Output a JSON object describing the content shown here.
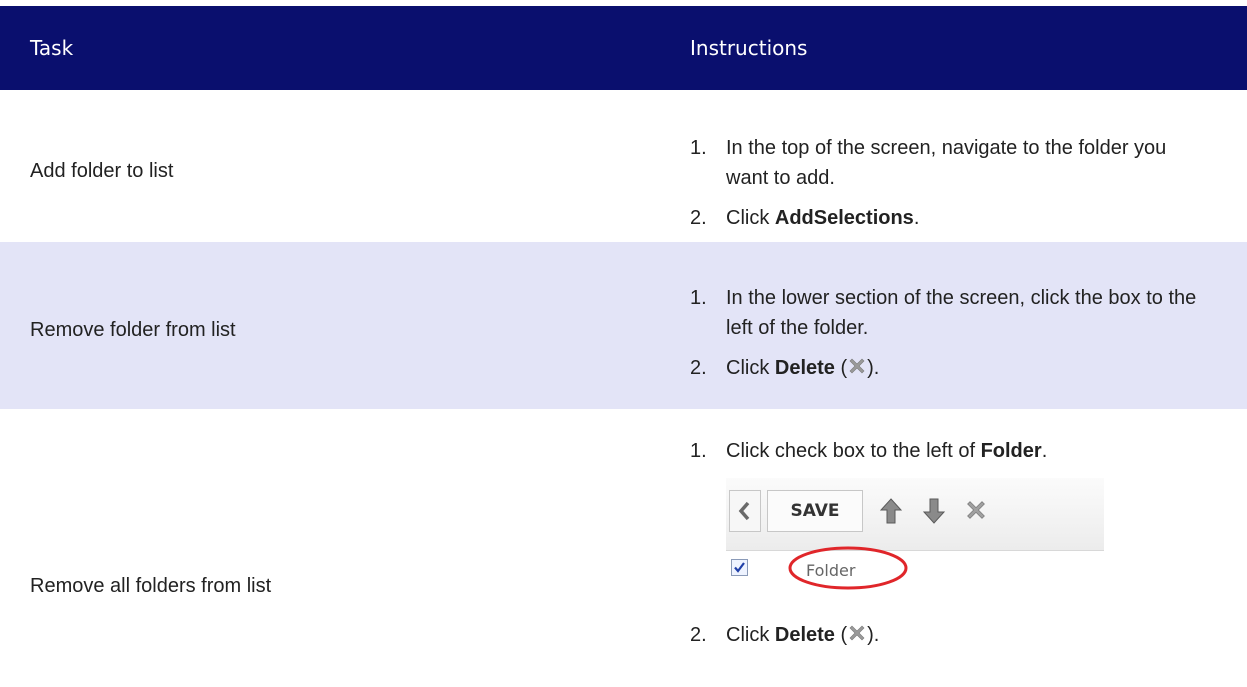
{
  "header": {
    "task_label": "Task",
    "instructions_label": "Instructions"
  },
  "rows": [
    {
      "task": "Add folder to list",
      "steps": [
        {
          "num": "1.",
          "text": "In the top of the screen, navigate to the folder you want to add."
        },
        {
          "num": "2.",
          "pre": "Click ",
          "bold": "AddSelections",
          "post": "."
        }
      ]
    },
    {
      "task": "Remove folder from list",
      "steps": [
        {
          "num": "1.",
          "text": "In the lower section of the screen, click the box to the left of the folder."
        },
        {
          "num": "2.",
          "pre": "Click ",
          "bold": "Delete",
          "post_open": " (",
          "post_close": ")."
        }
      ]
    },
    {
      "task": "Remove all folders from list",
      "steps": [
        {
          "num": "1.",
          "pre": "Click check box to the left of ",
          "bold": "Folder",
          "post": "."
        },
        {
          "num": "2.",
          "pre": "Click ",
          "bold": "Delete",
          "post_open": " (",
          "post_close": ")."
        }
      ],
      "screenshot": {
        "save_label": "SAVE",
        "folder_label": "Folder",
        "checkbox_checked": true
      }
    }
  ],
  "icons": {
    "delete": "delete-x-icon",
    "back": "chevron-left-icon",
    "up": "arrow-up-icon",
    "down": "arrow-down-icon"
  },
  "colors": {
    "header_bg": "#0a0f6e",
    "alt_row_bg": "#e3e4f7",
    "highlight_circle": "#e0262a"
  }
}
